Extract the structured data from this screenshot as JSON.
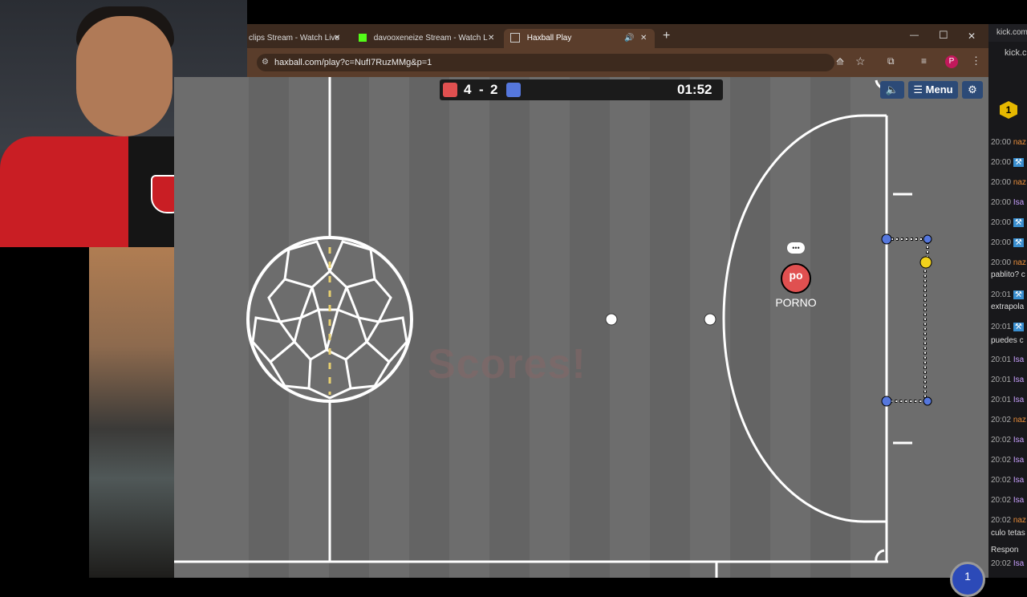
{
  "browser": {
    "tabs": [
      {
        "label": "clips Stream - Watch Live",
        "close": "✕"
      },
      {
        "label": "davooxeneize Stream - Watch L",
        "close": "✕"
      },
      {
        "label": "Haxball Play",
        "close": "✕"
      }
    ],
    "new_tab": "+",
    "url": "haxball.com/play?c=NufI7RuzMMg&p=1",
    "profile_initial": "P",
    "window": {
      "minimize": "—",
      "maximize": "☐",
      "close": "✕"
    }
  },
  "game": {
    "score_red": "4",
    "score_sep": "-",
    "score_blue": "2",
    "timer": "01:52",
    "menu_label": "Menu",
    "player_avatar": "po",
    "player_name": "PORNO",
    "overlay_text": "Scores!",
    "chat_bubble": "•••"
  },
  "chat_panel": {
    "header": "kick.com",
    "header2": "kick.c",
    "badge": "1",
    "lines": [
      {
        "time": "20:00",
        "name": "naz"
      },
      {
        "time": "20:00",
        "name": ""
      },
      {
        "time": "20:00",
        "name": "naz"
      },
      {
        "time": "20:00",
        "name": "Isa"
      },
      {
        "time": "20:00",
        "name": ""
      },
      {
        "time": "20:00",
        "name": ""
      },
      {
        "time": "20:00",
        "name": "naz"
      },
      {
        "time": "",
        "name": "pablito? c"
      },
      {
        "time": "20:01",
        "name": ""
      },
      {
        "time": "",
        "name": "extrapola"
      },
      {
        "time": "20:01",
        "name": ""
      },
      {
        "time": "",
        "name": "puedes c"
      },
      {
        "time": "20:01",
        "name": "Isa"
      },
      {
        "time": "20:01",
        "name": "Isa"
      },
      {
        "time": "20:01",
        "name": "Isa"
      },
      {
        "time": "20:02",
        "name": "naz"
      },
      {
        "time": "20:02",
        "name": "Isa"
      },
      {
        "time": "20:02",
        "name": "Isa"
      },
      {
        "time": "20:02",
        "name": "Isa"
      },
      {
        "time": "20:02",
        "name": "Isa"
      },
      {
        "time": "20:02",
        "name": "naz"
      },
      {
        "time": "",
        "name": "culo tetas"
      },
      {
        "time": "",
        "name": "Respon"
      },
      {
        "time": "20:02",
        "name": "Isa"
      }
    ]
  },
  "colors": {
    "red_team": "#e05050",
    "blue_team": "#5577dd",
    "ball": "#ffffff",
    "field": "#6d6d6d",
    "tab_bar": "#3c2a1f"
  }
}
